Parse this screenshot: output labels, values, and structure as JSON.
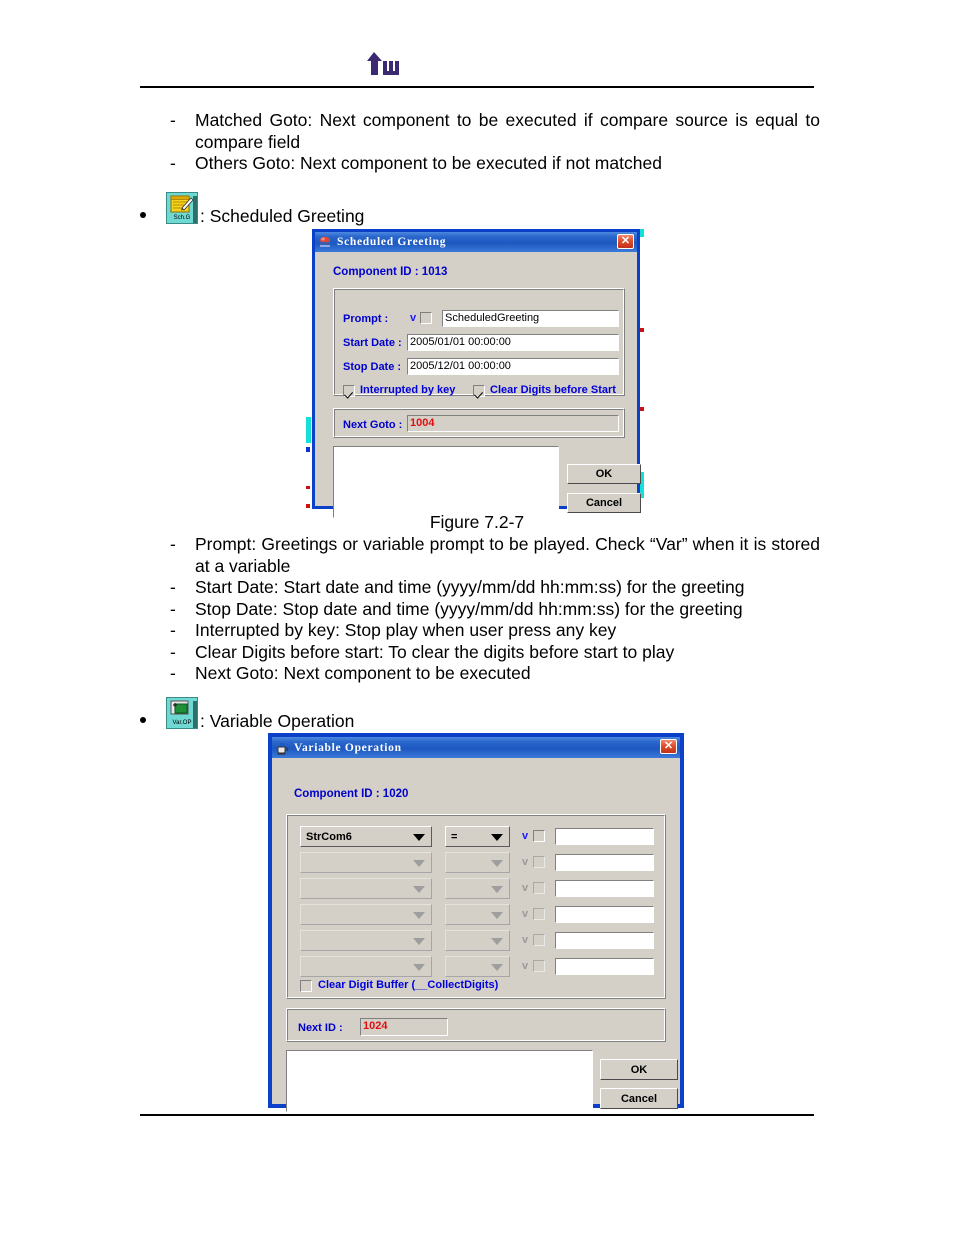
{
  "page": {
    "logo_alt": "tw-logo"
  },
  "section_top": {
    "items": [
      {
        "dash": "-",
        "text": "Matched Goto:  Next component to be executed if compare source is equal to compare field"
      },
      {
        "dash": "-",
        "text": "Others Goto: Next component to be executed if not matched"
      }
    ]
  },
  "bullets": {
    "scheduled_greeting": {
      "icon_caption": "Sch.G",
      "label": ": Scheduled Greeting"
    },
    "variable_operation": {
      "icon_caption": "Var.OP",
      "label": ": Variable Operation"
    }
  },
  "figure_caption": "Figure 7.2-7",
  "section_mid": {
    "items": [
      {
        "dash": "-",
        "text": "Prompt: Greetings or variable prompt to be played. Check “Var” when it is stored at a variable"
      },
      {
        "dash": "-",
        "text": "Start Date: Start date and time (yyyy/mm/dd hh:mm:ss) for the greeting"
      },
      {
        "dash": "-",
        "text": "Stop Date: Stop date and time (yyyy/mm/dd hh:mm:ss) for the greeting"
      },
      {
        "dash": "-",
        "text": "Interrupted by key: Stop play when user press any key"
      },
      {
        "dash": "-",
        "text": "Clear Digits before start: To clear the digits before start to play"
      },
      {
        "dash": "-",
        "text": "Next Goto: Next component to be executed"
      }
    ]
  },
  "dialog_scheduled_greeting": {
    "title": "Scheduled Greeting",
    "close_label": "✕",
    "component_id": "Component ID : 1013",
    "prompt_label": "Prompt :",
    "prompt_var_marker": "v",
    "prompt_var_checked": false,
    "prompt_value": "ScheduledGreeting",
    "start_date_label": "Start Date :",
    "start_date_value": "2005/01/01 00:00:00",
    "stop_date_label": "Stop Date :",
    "stop_date_value": "2005/12/01 00:00:00",
    "interrupted_label": "Interrupted by key",
    "interrupted_checked": true,
    "clear_digits_label": "Clear Digits before Start",
    "clear_digits_checked": true,
    "next_goto_label": "Next Goto :",
    "next_goto_value": "1004",
    "ok_label": "OK",
    "cancel_label": "Cancel",
    "notes_value": ""
  },
  "dialog_variable_operation": {
    "title": "Variable Operation",
    "close_label": "✕",
    "component_id": "Component ID : 1020",
    "rows": [
      {
        "variable": "StrCom6",
        "operator": "=",
        "var_marker": "v",
        "var_checked": false,
        "value": "",
        "enabled": true
      },
      {
        "variable": "",
        "operator": "",
        "var_marker": "v",
        "var_checked": false,
        "value": "",
        "enabled": false
      },
      {
        "variable": "",
        "operator": "",
        "var_marker": "v",
        "var_checked": false,
        "value": "",
        "enabled": false
      },
      {
        "variable": "",
        "operator": "",
        "var_marker": "v",
        "var_checked": false,
        "value": "",
        "enabled": false
      },
      {
        "variable": "",
        "operator": "",
        "var_marker": "v",
        "var_checked": false,
        "value": "",
        "enabled": false
      },
      {
        "variable": "",
        "operator": "",
        "var_marker": "v",
        "var_checked": false,
        "value": "",
        "enabled": false
      }
    ],
    "clear_digit_buffer_label": "Clear Digit Buffer (__CollectDigits)",
    "clear_digit_buffer_checked": false,
    "next_id_label": "Next ID :",
    "next_id_value": "1024",
    "ok_label": "OK",
    "cancel_label": "Cancel",
    "notes_value": ""
  },
  "colors": {
    "title_blue": "#1d57c0",
    "label_blue": "#0000cc",
    "value_red": "#e01010",
    "dialog_face": "#d4d0c8",
    "icon_teal": "#6fd9d3",
    "logo_purple": "#3b2a72"
  }
}
